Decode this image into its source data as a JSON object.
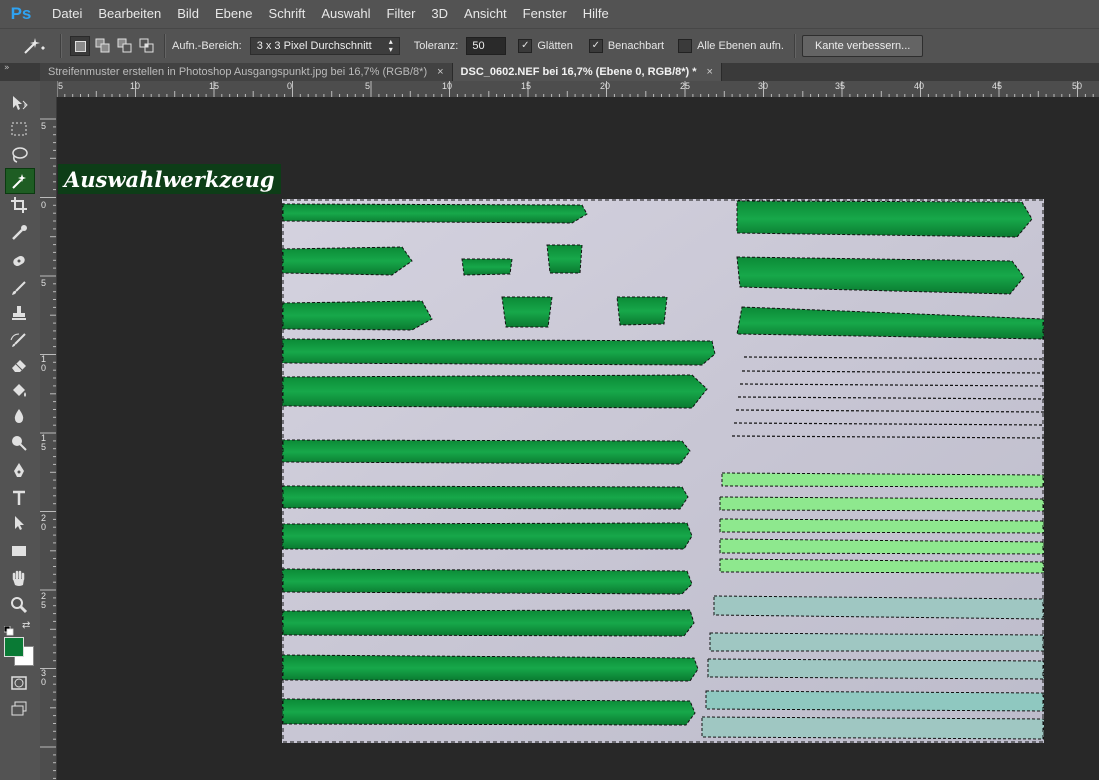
{
  "app": {
    "logo": "Ps"
  },
  "menu": [
    "Datei",
    "Bearbeiten",
    "Bild",
    "Ebene",
    "Schrift",
    "Auswahl",
    "Filter",
    "3D",
    "Ansicht",
    "Fenster",
    "Hilfe"
  ],
  "options": {
    "sample_label": "Aufn.-Bereich:",
    "sample_value": "3 x 3 Pixel Durchschnitt",
    "tolerance_label": "Toleranz:",
    "tolerance_value": "50",
    "antialias_label": "Glätten",
    "contiguous_label": "Benachbart",
    "all_layers_label": "Alle Ebenen aufn.",
    "refine_button": "Kante verbessern..."
  },
  "panel_header": "»",
  "tabs": [
    {
      "label": "Streifenmuster erstellen in Photoshop Ausgangspunkt.jpg bei 16,7% (RGB/8*)",
      "close": "×"
    },
    {
      "label": "DSC_0602.NEF bei 16,7% (Ebene 0, RGB/8*) *",
      "close": "×"
    }
  ],
  "hruler_labels": [
    "5",
    "10",
    "15",
    "20",
    "5",
    "0",
    "5",
    "10",
    "15",
    "20",
    "25",
    "30",
    "35",
    "40",
    "45",
    "50"
  ],
  "vruler_labels": [
    "5",
    "0",
    "5",
    "1 0",
    "1 5",
    "2 0",
    "2 5",
    "3 0"
  ],
  "annotation": "Auswahlwerkzeug",
  "colors": {
    "foreground": "#0a7a35",
    "background": "#ffffff",
    "active_tool": "#1e5d23",
    "stroke_green": "#12a040",
    "light_green": "#9af59a"
  }
}
